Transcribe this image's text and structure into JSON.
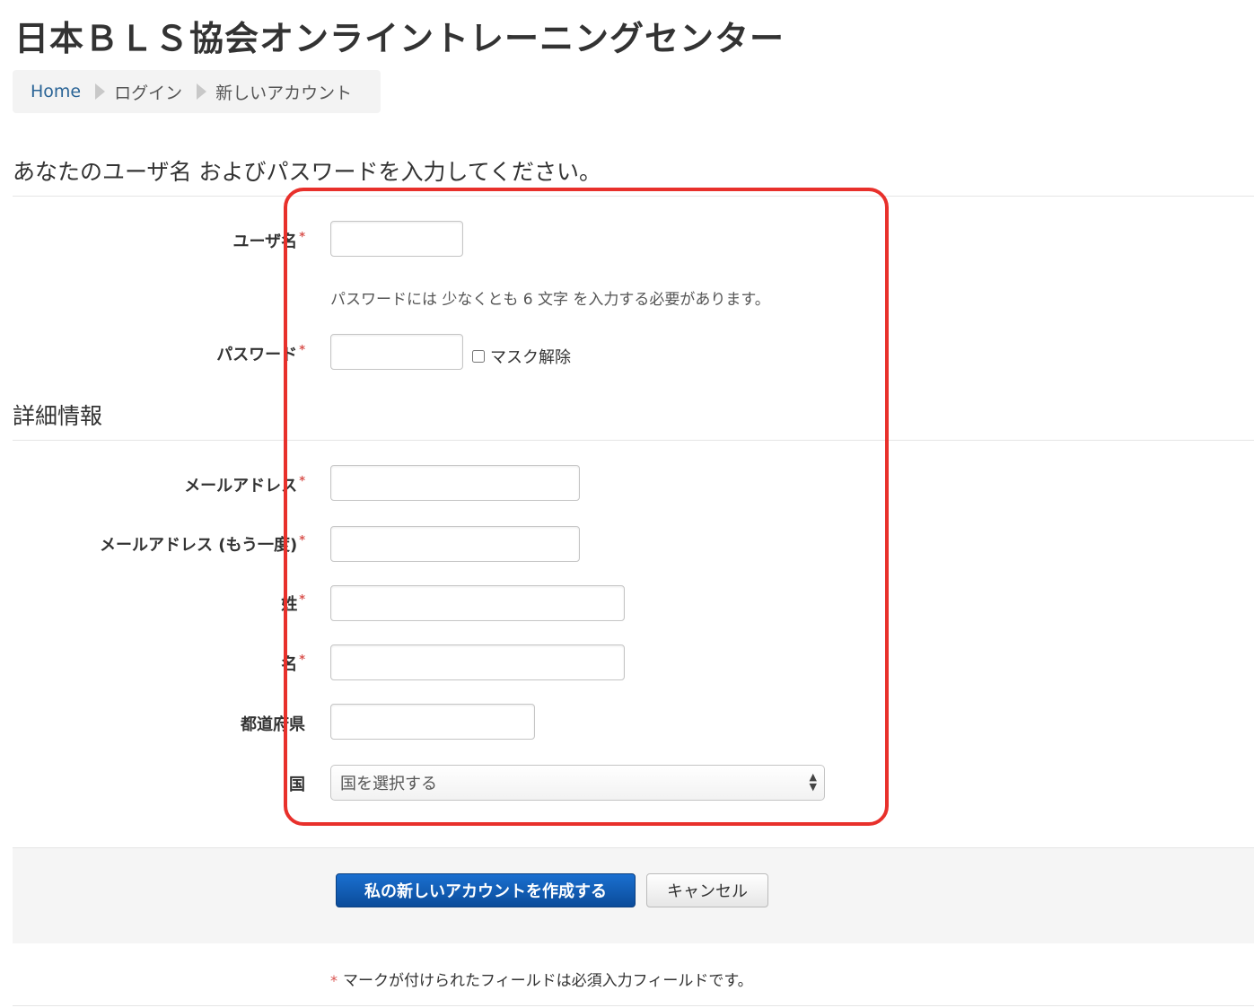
{
  "site_title": "日本ＢＬＳ協会オンライントレーニングセンター",
  "breadcrumb": {
    "home": "Home",
    "items": [
      "ログイン",
      "新しいアカウント"
    ]
  },
  "sections": {
    "login_legend": "あなたのユーザ名 およびパスワードを入力してください。",
    "details_legend": "詳細情報"
  },
  "fields": {
    "username": {
      "label": "ユーザ名",
      "value": ""
    },
    "password_note": "パスワードには 少なくとも 6 文字 を入力する必要があります。",
    "password": {
      "label": "パスワード",
      "value": ""
    },
    "unmask_label": "マスク解除",
    "email": {
      "label": "メールアドレス",
      "value": ""
    },
    "email_confirm": {
      "label": "メールアドレス (もう一度)",
      "value": ""
    },
    "lastname": {
      "label": "姓",
      "value": ""
    },
    "firstname": {
      "label": "名",
      "value": ""
    },
    "city": {
      "label": "都道府県",
      "value": ""
    },
    "country": {
      "label": "国",
      "selected": "国を選択する"
    }
  },
  "required_mark": "*",
  "buttons": {
    "create": "私の新しいアカウントを作成する",
    "cancel": "キャンセル"
  },
  "footer_note": "マークが付けられたフィールドは必須入力フィールドです。",
  "colors": {
    "required": "#d9534f",
    "highlight": "#e8302b",
    "primary_button": "#0b4c9a",
    "link": "#2a6496"
  }
}
